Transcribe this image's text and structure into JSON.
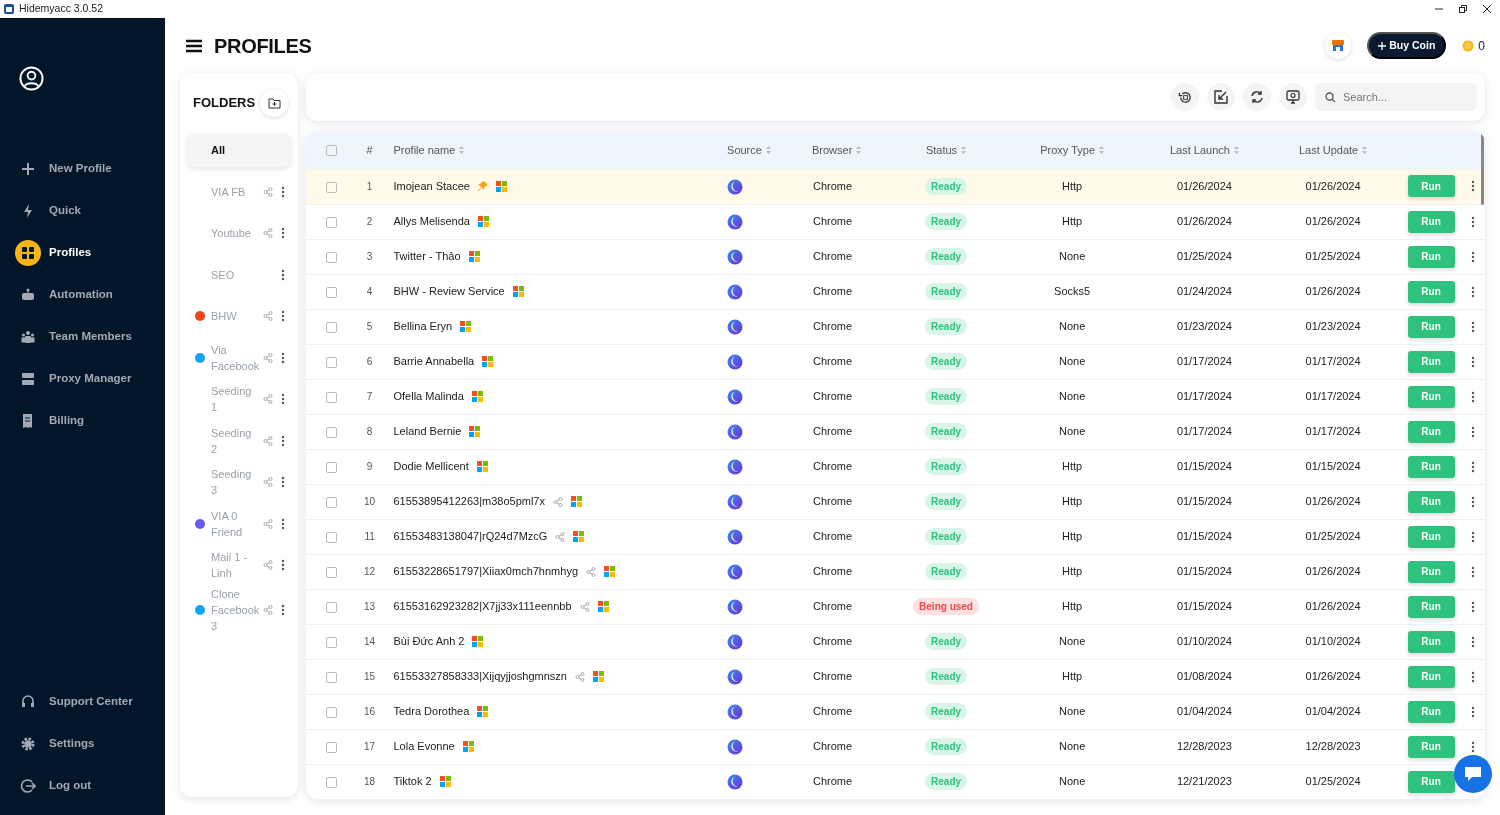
{
  "window": {
    "title": "Hidemyacc 3.0.52"
  },
  "sidebar": {
    "items": [
      {
        "label": "New Profile",
        "selected": false
      },
      {
        "label": "Quick",
        "selected": false
      },
      {
        "label": "Profiles",
        "selected": true
      },
      {
        "label": "Automation",
        "selected": false
      },
      {
        "label": "Team Members",
        "selected": false
      },
      {
        "label": "Proxy Manager",
        "selected": false
      },
      {
        "label": "Billing",
        "selected": false
      }
    ],
    "bottom_items": [
      {
        "label": "Support Center"
      },
      {
        "label": "Settings"
      },
      {
        "label": "Log out"
      }
    ]
  },
  "header": {
    "title": "PROFILES",
    "buy_button": "Buy Coin",
    "coins": "0"
  },
  "folders": {
    "title": "FOLDERS",
    "items": [
      {
        "name": "All",
        "selected": true,
        "shared": false,
        "menu": false
      },
      {
        "name": "VIA FB",
        "selected": false,
        "shared": true,
        "menu": true
      },
      {
        "name": "Youtube",
        "selected": false,
        "shared": true,
        "menu": true
      },
      {
        "name": "SEO",
        "selected": false,
        "shared": false,
        "menu": true
      },
      {
        "name": "BHW",
        "selected": false,
        "shared": true,
        "menu": true,
        "color": "#f0441a"
      },
      {
        "name": "Via Facebook",
        "selected": false,
        "shared": true,
        "menu": true,
        "color": "#12a4f5"
      },
      {
        "name": "Seeding 1",
        "selected": false,
        "shared": true,
        "menu": true
      },
      {
        "name": "Seeding 2",
        "selected": false,
        "shared": true,
        "menu": true
      },
      {
        "name": "Seeding 3",
        "selected": false,
        "shared": true,
        "menu": true
      },
      {
        "name": "VIA 0 Friend",
        "selected": false,
        "shared": true,
        "menu": true,
        "color": "#6b5cf0"
      },
      {
        "name": "Mail 1 - Linh",
        "selected": false,
        "shared": true,
        "menu": true
      },
      {
        "name": "Clone Facebook 3",
        "selected": false,
        "shared": true,
        "menu": true,
        "color": "#12a4f5"
      }
    ]
  },
  "search": {
    "placeholder": "Search..."
  },
  "table": {
    "select_all_checked": false,
    "columns": [
      {
        "label": "#",
        "sortable": false
      },
      {
        "label": "Profile name",
        "sortable": true
      },
      {
        "label": "Source",
        "sortable": true
      },
      {
        "label": "Browser",
        "sortable": true
      },
      {
        "label": "Status",
        "sortable": true
      },
      {
        "label": "Proxy Type",
        "sortable": true
      },
      {
        "label": "Last Launch",
        "sortable": true
      },
      {
        "label": "Last Update",
        "sortable": true
      }
    ],
    "rows": [
      {
        "num": "1",
        "name": "Imojean Stacee",
        "pinned": true,
        "shared": false,
        "checked": false,
        "browser": "Chrome",
        "status": {
          "text": "Ready",
          "kind": "ok"
        },
        "proxy": "Http",
        "last_launch": "01/26/2024",
        "last_update": "01/26/2024",
        "action": "Run"
      },
      {
        "num": "2",
        "name": "Allys Melisenda",
        "pinned": false,
        "shared": false,
        "checked": false,
        "browser": "Chrome",
        "status": {
          "text": "Ready",
          "kind": "ok"
        },
        "proxy": "Http",
        "last_launch": "01/26/2024",
        "last_update": "01/26/2024",
        "action": "Run"
      },
      {
        "num": "3",
        "name": "Twitter - Thảo",
        "pinned": false,
        "shared": false,
        "checked": false,
        "browser": "Chrome",
        "status": {
          "text": "Ready",
          "kind": "ok"
        },
        "proxy": "None",
        "last_launch": "01/25/2024",
        "last_update": "01/25/2024",
        "action": "Run"
      },
      {
        "num": "4",
        "name": "BHW - Review Service",
        "pinned": false,
        "shared": false,
        "checked": false,
        "browser": "Chrome",
        "status": {
          "text": "Ready",
          "kind": "ok"
        },
        "proxy": "Socks5",
        "last_launch": "01/24/2024",
        "last_update": "01/26/2024",
        "action": "Run"
      },
      {
        "num": "5",
        "name": "Bellina Eryn",
        "pinned": false,
        "shared": false,
        "checked": false,
        "browser": "Chrome",
        "status": {
          "text": "Ready",
          "kind": "ok"
        },
        "proxy": "None",
        "last_launch": "01/23/2024",
        "last_update": "01/23/2024",
        "action": "Run"
      },
      {
        "num": "6",
        "name": "Barrie Annabella",
        "pinned": false,
        "shared": false,
        "checked": false,
        "browser": "Chrome",
        "status": {
          "text": "Ready",
          "kind": "ok"
        },
        "proxy": "None",
        "last_launch": "01/17/2024",
        "last_update": "01/17/2024",
        "action": "Run"
      },
      {
        "num": "7",
        "name": "Ofella Malinda",
        "pinned": false,
        "shared": false,
        "checked": false,
        "browser": "Chrome",
        "status": {
          "text": "Ready",
          "kind": "ok"
        },
        "proxy": "None",
        "last_launch": "01/17/2024",
        "last_update": "01/17/2024",
        "action": "Run"
      },
      {
        "num": "8",
        "name": "Leland Bernie",
        "pinned": false,
        "shared": false,
        "checked": false,
        "browser": "Chrome",
        "status": {
          "text": "Ready",
          "kind": "ok"
        },
        "proxy": "None",
        "last_launch": "01/17/2024",
        "last_update": "01/17/2024",
        "action": "Run"
      },
      {
        "num": "9",
        "name": "Dodie Mellicent",
        "pinned": false,
        "shared": false,
        "checked": false,
        "browser": "Chrome",
        "status": {
          "text": "Ready",
          "kind": "ok"
        },
        "proxy": "Http",
        "last_launch": "01/15/2024",
        "last_update": "01/15/2024",
        "action": "Run"
      },
      {
        "num": "10",
        "name": "61553895412263|m38o5pml7x",
        "pinned": false,
        "shared": true,
        "checked": false,
        "browser": "Chrome",
        "status": {
          "text": "Ready",
          "kind": "ok"
        },
        "proxy": "Http",
        "last_launch": "01/15/2024",
        "last_update": "01/26/2024",
        "action": "Run"
      },
      {
        "num": "11",
        "name": "61553483138047|rQ24d7MzcG",
        "pinned": false,
        "shared": true,
        "checked": false,
        "browser": "Chrome",
        "status": {
          "text": "Ready",
          "kind": "ok"
        },
        "proxy": "Http",
        "last_launch": "01/15/2024",
        "last_update": "01/25/2024",
        "action": "Run"
      },
      {
        "num": "12",
        "name": "61553228651797|Xiiax0mch7hnmhyg",
        "pinned": false,
        "shared": true,
        "checked": false,
        "browser": "Chrome",
        "status": {
          "text": "Ready",
          "kind": "ok"
        },
        "proxy": "Http",
        "last_launch": "01/15/2024",
        "last_update": "01/26/2024",
        "action": "Run"
      },
      {
        "num": "13",
        "name": "61553162923282|X7jj33x111eennbb",
        "pinned": false,
        "shared": true,
        "checked": false,
        "browser": "Chrome",
        "status": {
          "text": "Being used",
          "kind": "busy"
        },
        "proxy": "Http",
        "last_launch": "01/15/2024",
        "last_update": "01/26/2024",
        "action": "Run"
      },
      {
        "num": "14",
        "name": "Bùi Đức Anh 2",
        "pinned": false,
        "shared": false,
        "checked": false,
        "browser": "Chrome",
        "status": {
          "text": "Ready",
          "kind": "ok"
        },
        "proxy": "None",
        "last_launch": "01/10/2024",
        "last_update": "01/10/2024",
        "action": "Run"
      },
      {
        "num": "15",
        "name": "61553327858333|Xijqyjjoshgmnszn",
        "pinned": false,
        "shared": true,
        "checked": false,
        "browser": "Chrome",
        "status": {
          "text": "Ready",
          "kind": "ok"
        },
        "proxy": "Http",
        "last_launch": "01/08/2024",
        "last_update": "01/26/2024",
        "action": "Run"
      },
      {
        "num": "16",
        "name": "Tedra Dorothea",
        "pinned": false,
        "shared": false,
        "checked": false,
        "browser": "Chrome",
        "status": {
          "text": "Ready",
          "kind": "ok"
        },
        "proxy": "None",
        "last_launch": "01/04/2024",
        "last_update": "01/04/2024",
        "action": "Run"
      },
      {
        "num": "17",
        "name": "Lola Evonne",
        "pinned": false,
        "shared": false,
        "checked": false,
        "browser": "Chrome",
        "status": {
          "text": "Ready",
          "kind": "ok"
        },
        "proxy": "None",
        "last_launch": "12/28/2023",
        "last_update": "12/28/2023",
        "action": "Run"
      },
      {
        "num": "18",
        "name": "Tiktok 2",
        "pinned": false,
        "shared": false,
        "checked": false,
        "browser": "Chrome",
        "status": {
          "text": "Ready",
          "kind": "ok"
        },
        "proxy": "None",
        "last_launch": "12/21/2023",
        "last_update": "01/25/2024",
        "action": "Run"
      }
    ]
  }
}
